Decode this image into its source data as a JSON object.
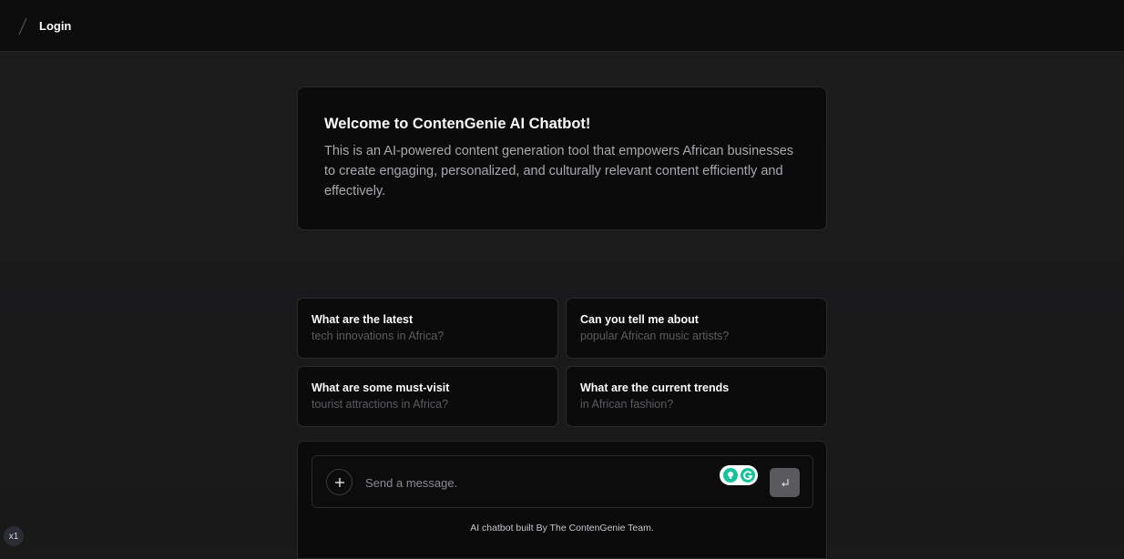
{
  "header": {
    "login_label": "Login"
  },
  "welcome": {
    "title": "Welcome to ContenGenie AI Chatbot!",
    "body": "This is an AI-powered content generation tool that empowers African businesses to create engaging, personalized, and culturally relevant content efficiently and effectively."
  },
  "suggestions": [
    {
      "title": "What are the latest",
      "subtitle": "tech innovations in Africa?"
    },
    {
      "title": "Can you tell me about",
      "subtitle": "popular African music artists?"
    },
    {
      "title": "What are some must-visit",
      "subtitle": "tourist attractions in Africa?"
    },
    {
      "title": "What are the current trends",
      "subtitle": "in African fashion?"
    }
  ],
  "composer": {
    "placeholder": "Send a message.",
    "value": "",
    "plus_icon": "plus-icon",
    "send_icon": "enter-return-icon",
    "extension_icon": "grammarly-icon",
    "footer": "AI chatbot built By The ContenGenie Team."
  },
  "zoom_badge": "x1",
  "colors": {
    "background": "#1a1a1b",
    "card": "#0b0b0c",
    "border": "#2a2a2d",
    "grammarly": "#15c39a",
    "send_button": "#5a5a5e"
  }
}
